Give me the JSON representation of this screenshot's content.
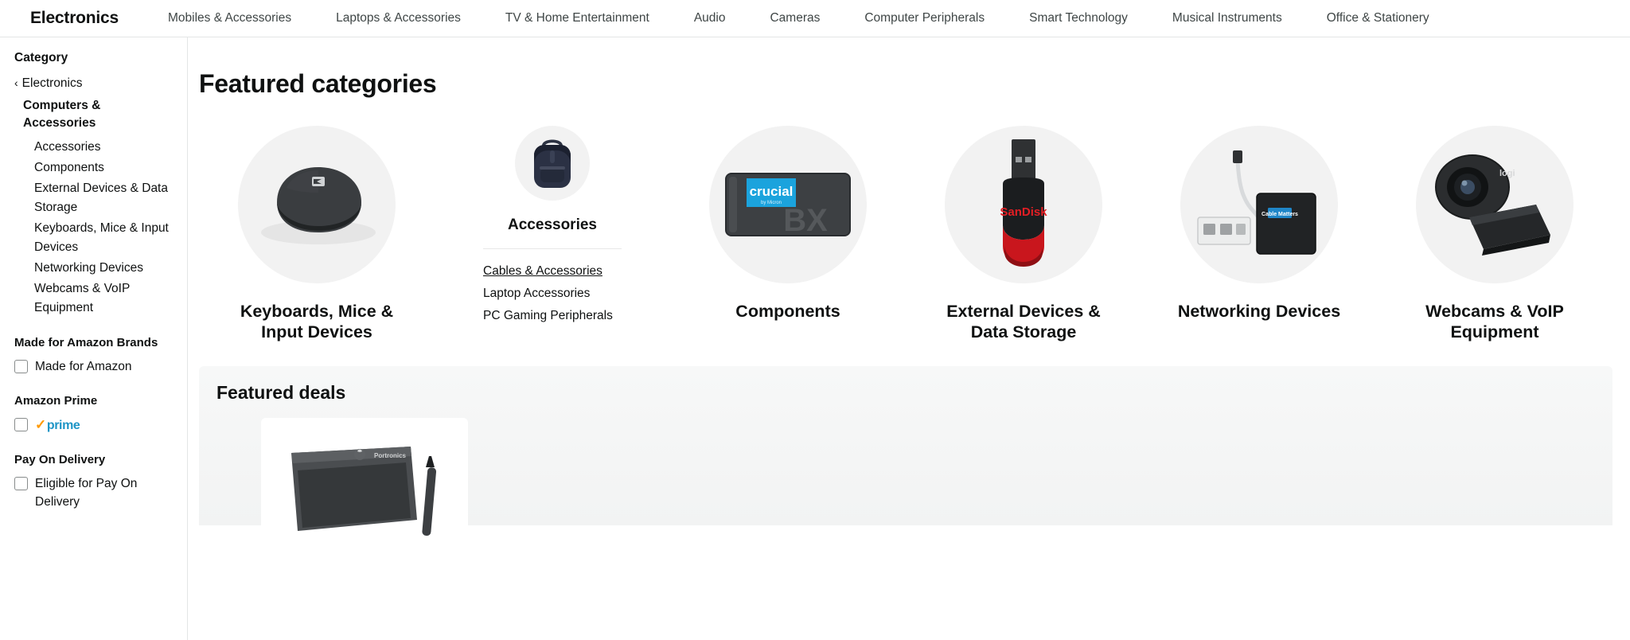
{
  "topnav": {
    "brand": "Electronics",
    "links": [
      "Mobiles & Accessories",
      "Laptops & Accessories",
      "TV & Home Entertainment",
      "Audio",
      "Cameras",
      "Computer Peripherals",
      "Smart Technology",
      "Musical Instruments",
      "Office & Stationery"
    ]
  },
  "sidebar": {
    "heading": "Category",
    "back_label": "Electronics",
    "back_chevron": "chevron-left-icon",
    "current": "Computers & Accessories",
    "subcategories": [
      "Accessories",
      "Components",
      "External Devices & Data Storage",
      "Keyboards, Mice & Input Devices",
      "Networking Devices",
      "Webcams & VoIP Equipment"
    ],
    "filters": [
      {
        "title": "Made for Amazon Brands",
        "option_label": "Made for Amazon",
        "checked": false,
        "is_prime": false
      },
      {
        "title": "Amazon Prime",
        "option_label": "prime",
        "checked": false,
        "is_prime": true,
        "prime_check": "✓"
      },
      {
        "title": "Pay On Delivery",
        "option_label": "Eligible for Pay On Delivery",
        "checked": false,
        "is_prime": false
      }
    ]
  },
  "main": {
    "title": "Featured categories",
    "cards": [
      {
        "label": "Keyboards, Mice & Input Devices",
        "art": "mouse-image",
        "size": "large"
      },
      {
        "label": "Accessories",
        "art": "backpack-image",
        "size": "small",
        "sublinks": [
          {
            "text": "Cables & Accessories",
            "underlined": true
          },
          {
            "text": "Laptop Accessories",
            "underlined": false
          },
          {
            "text": "PC Gaming Peripherals",
            "underlined": false
          }
        ]
      },
      {
        "label": "Components",
        "art": "ssd-image",
        "size": "large"
      },
      {
        "label": "External Devices & Data Storage",
        "art": "usb-flash-drive-image",
        "size": "large"
      },
      {
        "label": "Networking Devices",
        "art": "network-adapter-image",
        "size": "large"
      },
      {
        "label": "Webcams & VoIP Equipment",
        "art": "webcam-image",
        "size": "large"
      }
    ]
  },
  "deals": {
    "title": "Featured deals",
    "card_art": "graphics-tablet-image"
  },
  "colors": {
    "text": "#0f1111",
    "nav_text": "#3f4646",
    "circle_bg": "#f2f2f2",
    "border": "#e3e6e6",
    "prime_blue": "#1e95c6",
    "prime_orange": "#ff9900",
    "crucial_blue": "#1ba3dd",
    "sandisk_red": "#e31e24",
    "deals_bg": "#f4f5f5"
  },
  "brand_text": {
    "crucial": "crucial",
    "crucial_sub": "by Micron",
    "ssd_model": "BX",
    "sandisk": "SanDisk",
    "logitech": "logi",
    "tablet_brand": "Portronics"
  }
}
